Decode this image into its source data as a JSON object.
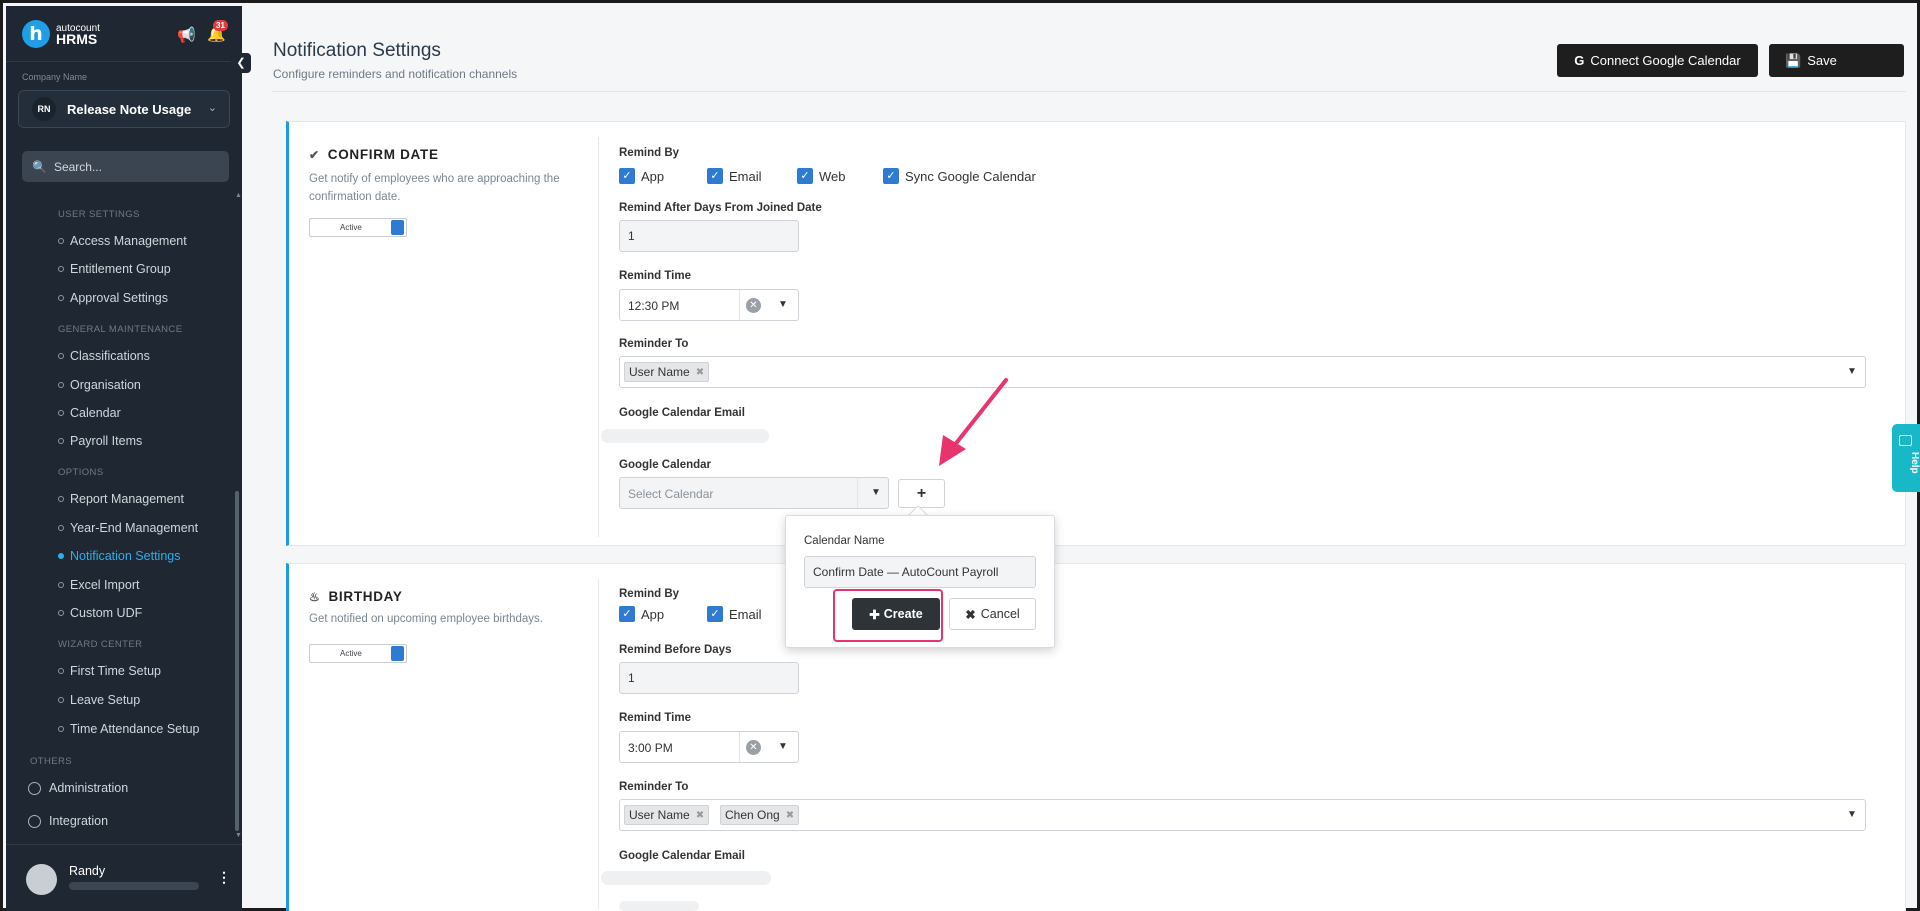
{
  "app": {
    "logo_letter": "h",
    "brand_small": "autocount",
    "brand_big": "HRMS",
    "notif_count": "31"
  },
  "company": {
    "label": "Company Name",
    "initials": "RN",
    "name": "Release Note Usage"
  },
  "search": {
    "placeholder": "Search..."
  },
  "menu": {
    "sections": [
      {
        "title": "USER SETTINGS",
        "items": [
          "Access Management",
          "Entitlement Group",
          "Approval Settings"
        ]
      },
      {
        "title": "GENERAL MAINTENANCE",
        "items": [
          "Classifications",
          "Organisation",
          "Calendar",
          "Payroll Items"
        ]
      },
      {
        "title": "OPTIONS",
        "items": [
          "Report Management",
          "Year-End Management",
          "Notification Settings",
          "Excel Import",
          "Custom UDF"
        ]
      },
      {
        "title": "WIZARD CENTER",
        "items": [
          "First Time Setup",
          "Leave Setup",
          "Time Attendance Setup"
        ]
      }
    ],
    "active": "Notification Settings",
    "others_title": "OTHERS",
    "others": [
      "Administration",
      "Integration"
    ]
  },
  "user": {
    "name": "Randy"
  },
  "page": {
    "title": "Notification Settings",
    "subtitle": "Configure reminders and notification channels",
    "connect_label": "Connect Google Calendar",
    "save_label": "Save"
  },
  "confirm": {
    "title": "CONFIRM DATE",
    "desc": "Get notify of employees who are approaching the confirmation date.",
    "toggle": "Active",
    "remind_by_label": "Remind By",
    "channels": [
      "App",
      "Email",
      "Web",
      "Sync Google Calendar"
    ],
    "days_label": "Remind After Days From Joined Date",
    "days_value": "1",
    "time_label": "Remind Time",
    "time_value": "12:30 PM",
    "reminder_to_label": "Reminder To",
    "reminder_to": [
      "User Name"
    ],
    "gcal_email_label": "Google Calendar Email",
    "gcal_label": "Google Calendar",
    "gcal_placeholder": "Select Calendar",
    "add_label": "+"
  },
  "popover": {
    "label": "Calendar Name",
    "value": "Confirm Date — AutoCount Payroll",
    "create_label": "Create",
    "cancel_label": "Cancel"
  },
  "birthday": {
    "title": "BIRTHDAY",
    "desc": "Get notified on upcoming employee birthdays.",
    "toggle": "Active",
    "remind_by_label": "Remind By",
    "channels": [
      "App",
      "Email"
    ],
    "days_label": "Remind Before Days",
    "days_value": "1",
    "time_label": "Remind Time",
    "time_value": "3:00 PM",
    "reminder_to_label": "Reminder To",
    "reminder_to": [
      "User Name",
      "Chen Ong"
    ],
    "gcal_email_label": "Google Calendar Email"
  },
  "help": {
    "label": "Help"
  },
  "colors": {
    "accent": "#1e9be0",
    "active_menu": "#2ab0ee",
    "checkbox": "#2f7bd1",
    "highlight": "#e8336d",
    "sidebar": "#1e2732",
    "help": "#19b8c8"
  }
}
